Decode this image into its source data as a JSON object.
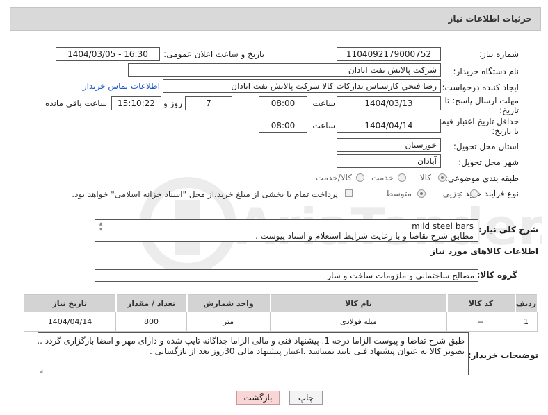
{
  "page": {
    "title": "جزئیات اطلاعات نیاز"
  },
  "fields": {
    "need_number_label": "شماره نیاز:",
    "need_number": "1104092179000752",
    "announce_label": "تاریخ و ساعت اعلان عمومی:",
    "announce_value": "1404/03/05 - 16:30",
    "buyer_org_label": "نام دستگاه خریدار:",
    "buyer_org": "شرکت پالایش نفت ابادان",
    "creator_label": "ایجاد کننده درخواست:",
    "creator": "رضا فتحي كارشناس تداركات كالا  شركت پالايش نفت ابادان",
    "contact_link": "اطلاعات تماس خریدار",
    "deadline_label_1": "مهلت ارسال پاسخ: تا",
    "deadline_label_2": "تاریخ:",
    "deadline_date": "1404/03/13",
    "time_word": "ساعت",
    "deadline_time": "08:00",
    "days_value": "7",
    "days_word": "روز و",
    "remaining_time": "15:10:22",
    "remaining_word": "ساعت باقی مانده",
    "price_label_1": "حداقل تاریخ اعتبار قیمت:",
    "price_label_2": "تا تاریخ:",
    "price_date": "1404/04/14",
    "price_time": "08:00",
    "province_label": "استان محل تحویل:",
    "province": "خوزستان",
    "city_label": "شهر محل تحویل:",
    "city": "آبادان",
    "category_label": "طبقه بندی موضوعی:",
    "category_options": [
      "کالا",
      "خدمت",
      "کالا/خدمت"
    ],
    "process_label": "نوع فرآیند خرید :",
    "process_options": [
      "جزیی",
      "متوسط"
    ],
    "payment_note": "پرداخت تمام یا بخشی از مبلغ خرید،از محل \"اسناد خزانه اسلامی\" خواهد بود."
  },
  "description": {
    "label": "شرح کلی نیاز:",
    "line1": "mild steel bars",
    "line2": "مطابق شرح تقاضا و با رعایت شرایط استعلام و اسناد پیوست ."
  },
  "goods": {
    "section_title": "اطلاعات کالاهای مورد نیاز",
    "group_label": "گروه کالا:",
    "group_value": "مصالح ساختمانی و ملزومات ساخت و ساز",
    "columns": [
      "ردیف",
      "کد کالا",
      "نام کالا",
      "واحد شمارش",
      "تعداد / مقدار",
      "تاریخ نیاز"
    ],
    "rows": [
      [
        "1",
        "--",
        "میله فولادی",
        "متر",
        "800",
        "1404/04/14"
      ]
    ]
  },
  "buyer_notes": {
    "label": "توضیحات خریدار:",
    "line1": "طبق شرح تقاضا و پیوست الزاما درجه 1. پیشنهاد فنی و مالی الزاما جداگانه تایپ شده و دارای مهر و امضا بارگزاری گردد ..",
    "line2": "تصویر کالا به عنوان پیشنهاد فنی تایید نمیباشد .اعتبار پیشنهاد مالی 30روز بعد از بازگشایی ."
  },
  "buttons": {
    "print": "چاپ",
    "back": "بازگشت"
  },
  "watermark": "AriaTender.net",
  "colors": {
    "header_bg": "#d9d9d9",
    "link": "#1a56c9",
    "back_button": "#f8d6d6"
  }
}
